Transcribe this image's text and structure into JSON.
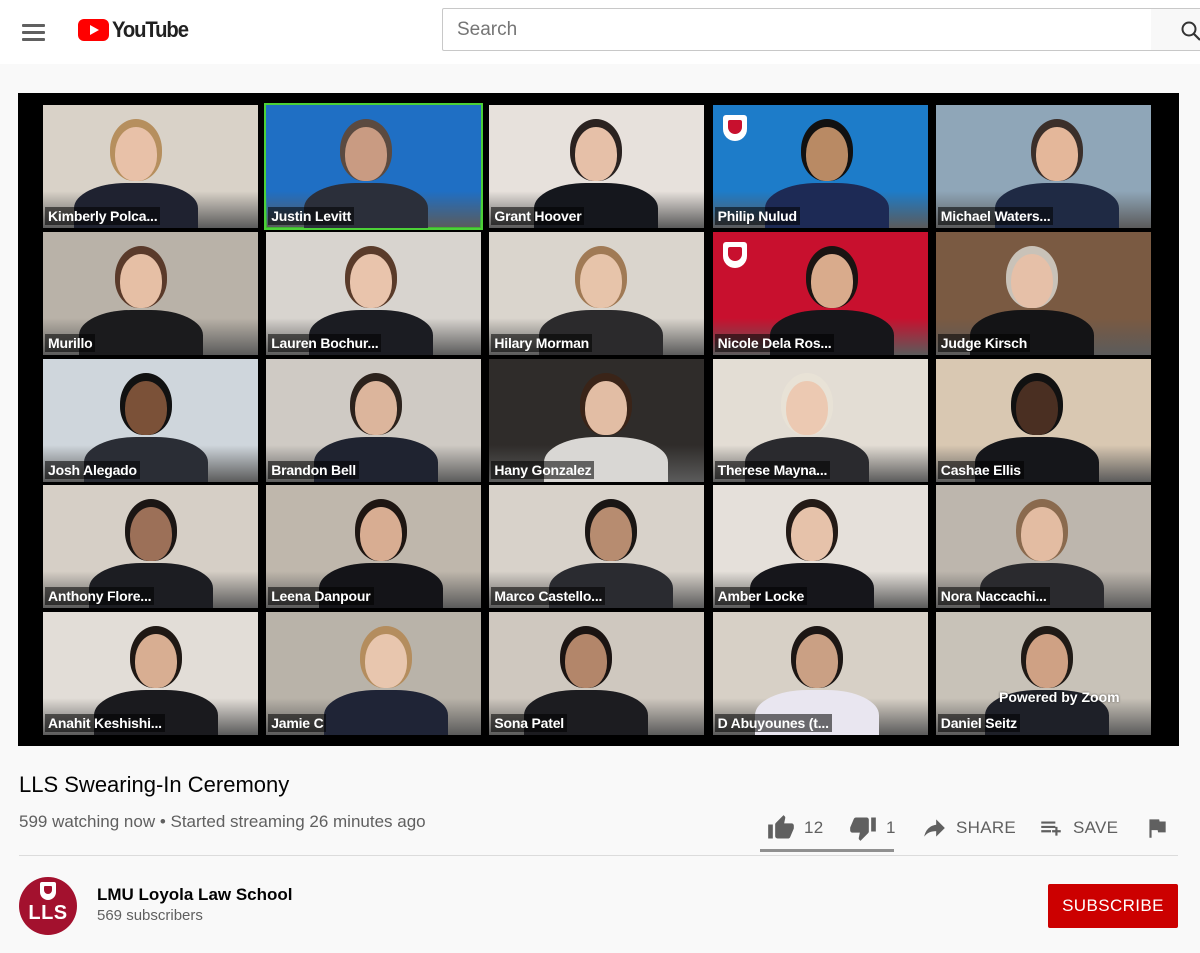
{
  "header": {
    "brand": "YouTube",
    "search_placeholder": "Search"
  },
  "player": {
    "overlay_text": "Powered by Zoom",
    "participants": [
      {
        "name": "Kimberly Polca...",
        "active": false,
        "bg": "#d9d2c8",
        "body": "#1f2230",
        "skin": "#e8c1a8",
        "hair": "#b68f5e"
      },
      {
        "name": "Justin Levitt",
        "active": true,
        "bg": "#1f6fc4",
        "body": "#2b2f3a",
        "skin": "#c99b82",
        "hair": "#5b4a40"
      },
      {
        "name": "Grant Hoover",
        "active": false,
        "bg": "#e7e1dc",
        "body": "#15171d",
        "skin": "#e6c0a8",
        "hair": "#2a2220"
      },
      {
        "name": "Philip Nulud",
        "active": false,
        "bg": "#1d7cc9",
        "body": "#1d2a55",
        "skin": "#b98a64",
        "hair": "#111"
      },
      {
        "name": "Michael Waters...",
        "active": false,
        "bg": "#8fa6b8",
        "body": "#1f2a44",
        "skin": "#e4b79a",
        "hair": "#3b2f2a"
      },
      {
        "name": "Murillo",
        "active": false,
        "bg": "#b9b2a8",
        "body": "#1b1b1d",
        "skin": "#e6bfa5",
        "hair": "#5a3a2a"
      },
      {
        "name": "Lauren Bochur...",
        "active": false,
        "bg": "#d8d4cf",
        "body": "#1b1c22",
        "skin": "#e9c4ac",
        "hair": "#5a3b2a"
      },
      {
        "name": "Hilary Morman",
        "active": false,
        "bg": "#dad5cd",
        "body": "#2b2a2c",
        "skin": "#e7c4aa",
        "hair": "#a07a55"
      },
      {
        "name": "Nicole Dela Ros...",
        "active": false,
        "bg": "#c8102e",
        "body": "#16161a",
        "skin": "#d9ab8c",
        "hair": "#1a1412"
      },
      {
        "name": "Judge Kirsch",
        "active": false,
        "bg": "#7a5a42",
        "body": "#141416",
        "skin": "#e6c0a8",
        "hair": "#c9c2b8"
      },
      {
        "name": "Josh Alegado",
        "active": false,
        "bg": "#cfd6dc",
        "body": "#2a2d35",
        "skin": "#7b5138",
        "hair": "#111"
      },
      {
        "name": "Brandon Bell",
        "active": false,
        "bg": "#cfcac4",
        "body": "#1f2330",
        "skin": "#dcb59c",
        "hair": "#2c221c"
      },
      {
        "name": "Hany Gonzalez",
        "active": false,
        "bg": "#2f2c2a",
        "body": "#d9d7d4",
        "skin": "#e2bda4",
        "hair": "#3a2418"
      },
      {
        "name": "Therese Mayna...",
        "active": false,
        "bg": "#e3ddd4",
        "body": "#2a2a2e",
        "skin": "#ecc9b2",
        "hair": "#e8e2d6"
      },
      {
        "name": "Cashae Ellis",
        "active": false,
        "bg": "#d9c8b2",
        "body": "#15161a",
        "skin": "#4a2f22",
        "hair": "#111"
      },
      {
        "name": "Anthony Flore...",
        "active": false,
        "bg": "#d6cfc6",
        "body": "#1c1d22",
        "skin": "#9c7058",
        "hair": "#1b1614"
      },
      {
        "name": "Leena Danpour",
        "active": false,
        "bg": "#bfb7ac",
        "body": "#141418",
        "skin": "#d8ad92",
        "hair": "#1e1612"
      },
      {
        "name": "Marco Castello...",
        "active": false,
        "bg": "#d8d2ca",
        "body": "#2a2b30",
        "skin": "#b78c70",
        "hair": "#1a1614"
      },
      {
        "name": "Amber Locke",
        "active": false,
        "bg": "#e5e0da",
        "body": "#16161b",
        "skin": "#e6c2aa",
        "hair": "#231a16"
      },
      {
        "name": "Nora Naccachi...",
        "active": false,
        "bg": "#bdb6ad",
        "body": "#2a2a2e",
        "skin": "#e3bca2",
        "hair": "#8a6a4e"
      },
      {
        "name": "Anahit Keshishi...",
        "active": false,
        "bg": "#e2ddd7",
        "body": "#1a1a1e",
        "skin": "#d8ae92",
        "hair": "#1f1814"
      },
      {
        "name": "Jamie C",
        "active": false,
        "bg": "#b9b3a9",
        "body": "#1f2436",
        "skin": "#e8c6ae",
        "hair": "#b48d5e"
      },
      {
        "name": "Sona Patel",
        "active": false,
        "bg": "#cfc8bf",
        "body": "#1c1c20",
        "skin": "#b3866a",
        "hair": "#1b1412"
      },
      {
        "name": "D Abuyounes (t...",
        "active": false,
        "bg": "#d7d0c6",
        "body": "#e9e6f0",
        "skin": "#caa084",
        "hair": "#1c1614"
      },
      {
        "name": "Daniel Seitz",
        "active": false,
        "bg": "#c8c2b8",
        "body": "#1e2028",
        "skin": "#cfa184",
        "hair": "#201a16"
      }
    ]
  },
  "video": {
    "title": "LLS Swearing-In Ceremony",
    "meta": "599 watching now • Started streaming 26 minutes ago",
    "likes": "12",
    "dislikes": "1",
    "like_ratio": 0.92,
    "share_label": "SHARE",
    "save_label": "SAVE"
  },
  "channel": {
    "avatar_text": "LLS",
    "name": "LMU Loyola Law School",
    "subscribers": "569 subscribers",
    "subscribe_label": "SUBSCRIBE",
    "brand_color": "#a3112e"
  },
  "icons": [
    "menu-icon",
    "youtube-logo-icon",
    "search-icon",
    "thumbs-up-icon",
    "thumbs-down-icon",
    "share-icon",
    "playlist-add-icon",
    "flag-icon"
  ]
}
